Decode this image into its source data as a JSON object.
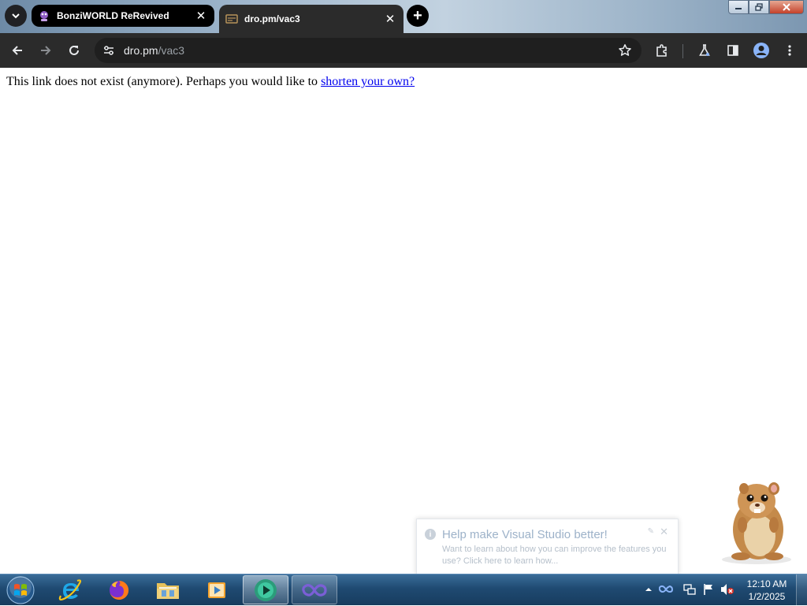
{
  "tabs": [
    {
      "title": "BonziWORLD ReRevived",
      "active": false
    },
    {
      "title": "dro.pm/vac3",
      "active": true
    }
  ],
  "toolbar": {
    "url_host": "dro.pm",
    "url_path": "/vac3"
  },
  "page": {
    "message": "This link does not exist (anymore). Perhaps you would like to ",
    "link_text": "shorten your own?"
  },
  "toast": {
    "title": "Help make Visual Studio better!",
    "body": "Want to learn about how you can improve the features you use? Click here to learn how..."
  },
  "clock": {
    "time": "12:10 AM",
    "date": "1/2/2025"
  },
  "taskbar": {
    "apps": [
      "internet-explorer",
      "firefox",
      "file-explorer",
      "media-player",
      "bonzi-player",
      "visual-studio"
    ]
  },
  "colors": {
    "chrome_dark": "#2b2b2b",
    "link": "#0000ee",
    "taskbar": "#1f4a72"
  }
}
